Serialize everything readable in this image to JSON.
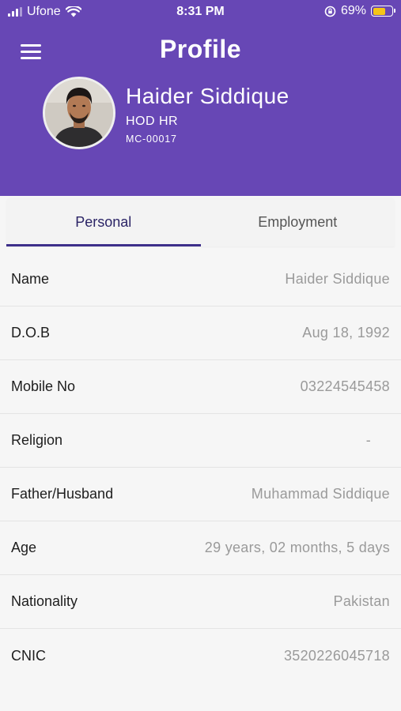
{
  "status_bar": {
    "carrier": "Ufone",
    "time": "8:31 PM",
    "battery_percent": "69%",
    "battery_level": 0.69,
    "battery_color": "#f5c518"
  },
  "header": {
    "title": "Profile",
    "background_color": "#6747b5",
    "menu_icon": "hamburger-menu-icon"
  },
  "profile": {
    "name": "Haider Siddique",
    "role": "HOD HR",
    "employee_id": "MC-00017"
  },
  "tabs": [
    {
      "label": "Personal",
      "active": true
    },
    {
      "label": "Employment",
      "active": false
    }
  ],
  "personal": [
    {
      "label": "Name",
      "value": "Haider Siddique"
    },
    {
      "label": "D.O.B",
      "value": "Aug 18, 1992"
    },
    {
      "label": "Mobile No",
      "value": "03224545458"
    },
    {
      "label": "Religion",
      "value": "-"
    },
    {
      "label": "Father/Husband",
      "value": "Muhammad Siddique"
    },
    {
      "label": "Age",
      "value": "29 years, 02 months, 5 days"
    },
    {
      "label": "Nationality",
      "value": "Pakistan"
    },
    {
      "label": "CNIC",
      "value": "3520226045718"
    }
  ]
}
